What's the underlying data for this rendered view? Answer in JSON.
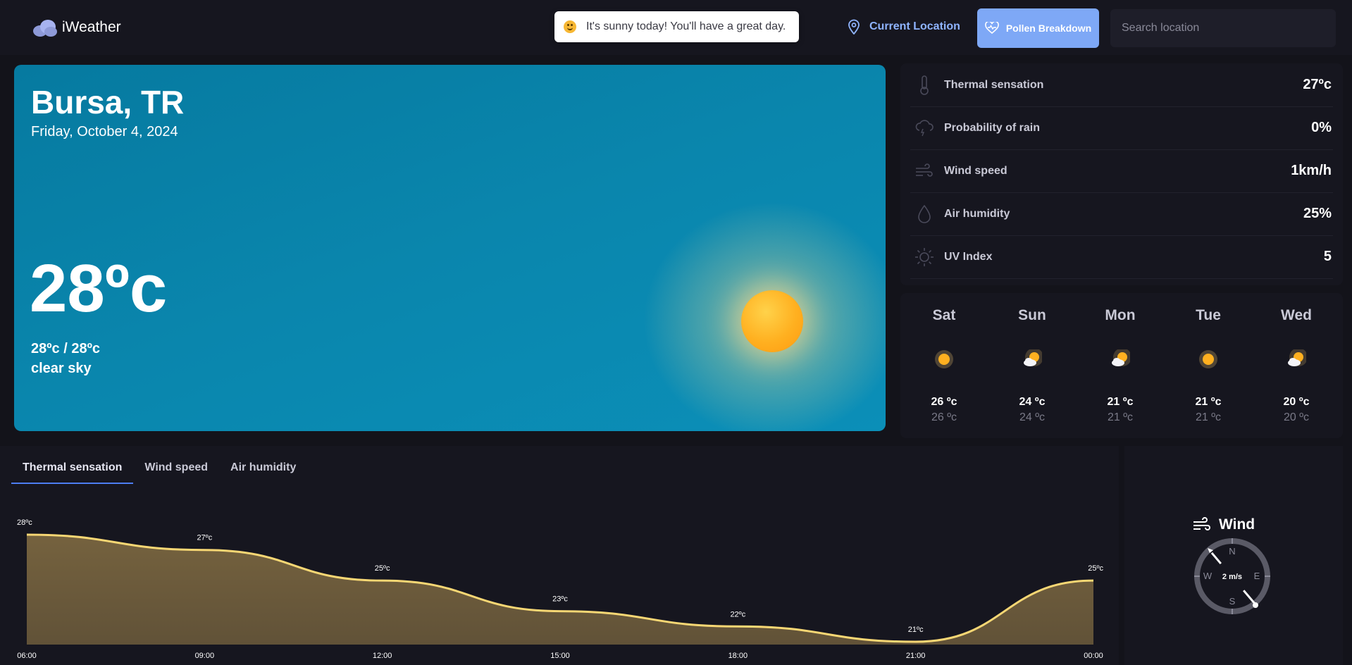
{
  "app": {
    "name": "iWeather"
  },
  "toast": {
    "message": "It's sunny today! You'll have a great day."
  },
  "nav": {
    "current_location": "Current Location",
    "pollen": "Pollen Breakdown"
  },
  "search": {
    "placeholder": "Search location"
  },
  "hero": {
    "city": "Bursa, TR",
    "date": "Friday, October 4, 2024",
    "temp": "28ºc",
    "minmax": "28ºc / 28ºc",
    "description": "clear sky"
  },
  "details": [
    {
      "icon": "thermometer-icon",
      "label": "Thermal sensation",
      "value": "27ºc"
    },
    {
      "icon": "cloud-rain-icon",
      "label": "Probability of rain",
      "value": "0%"
    },
    {
      "icon": "wind-icon",
      "label": "Wind speed",
      "value": "1km/h"
    },
    {
      "icon": "drop-icon",
      "label": "Air humidity",
      "value": "25%"
    },
    {
      "icon": "sun-icon",
      "label": "UV Index",
      "value": "5"
    }
  ],
  "forecast": [
    {
      "day": "Sat",
      "icon": "sun-icon",
      "hi": "26 ºc",
      "lo": "26 ºc"
    },
    {
      "day": "Sun",
      "icon": "partly-cloudy-icon",
      "hi": "24 ºc",
      "lo": "24 ºc"
    },
    {
      "day": "Mon",
      "icon": "partly-cloudy-icon",
      "hi": "21 ºc",
      "lo": "21 ºc"
    },
    {
      "day": "Tue",
      "icon": "sun-icon",
      "hi": "21 ºc",
      "lo": "21 ºc"
    },
    {
      "day": "Wed",
      "icon": "partly-cloudy-icon",
      "hi": "20 ºc",
      "lo": "20 ºc"
    }
  ],
  "tabs": [
    "Thermal sensation",
    "Wind speed",
    "Air humidity"
  ],
  "active_tab": 0,
  "chart_data": {
    "type": "area",
    "x": [
      "06:00",
      "09:00",
      "12:00",
      "15:00",
      "18:00",
      "21:00",
      "00:00"
    ],
    "values": [
      28,
      27,
      25,
      23,
      22,
      21,
      25
    ],
    "data_labels": [
      "28ºc",
      "27ºc",
      "25ºc",
      "23ºc",
      "22ºc",
      "21ºc",
      "25ºc"
    ],
    "ylim": [
      21,
      28
    ],
    "line_color": "#f7d774",
    "fill_color": "#7a6640"
  },
  "wind": {
    "title": "Wind",
    "speed": "2 m/s",
    "directions": {
      "n": "N",
      "e": "E",
      "s": "S",
      "w": "W"
    }
  },
  "colors": {
    "accent": "#7ea8f6",
    "background": "#13131a",
    "panel": "#16161f",
    "hero": "#0a86ad"
  }
}
